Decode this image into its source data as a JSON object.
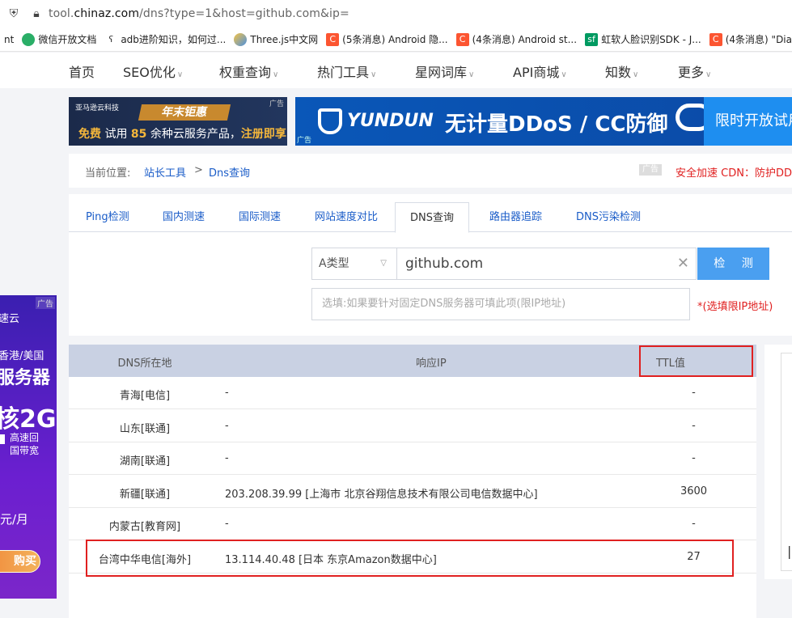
{
  "browser": {
    "url_prefix": "tool.",
    "url_domain": "chinaz.com",
    "url_rest": "/dns?type=1&host=github.com&ip=",
    "bookmarks": [
      {
        "label": "nt",
        "icon": "none",
        "color": "#ffffff"
      },
      {
        "label": "微信开放文档",
        "icon": "wechat-icon",
        "color": "#2aae67"
      },
      {
        "label": "adb进阶知识，如何过...",
        "icon": "bookmark-icon",
        "color": "#444444"
      },
      {
        "label": "Three.js中文网",
        "icon": "threejs-icon",
        "color": "#4a90e2"
      },
      {
        "label": "(5条消息) Android 隐...",
        "icon": "csdn-icon",
        "color": "#fc5531"
      },
      {
        "label": "(4条消息) Android st...",
        "icon": "csdn-icon",
        "color": "#fc5531"
      },
      {
        "label": "虹软人脸识别SDK - J...",
        "icon": "segmentfault-icon",
        "color": "#009a61"
      },
      {
        "label": "(4条消息) \"Dial",
        "icon": "csdn-icon",
        "color": "#fc5531"
      }
    ]
  },
  "topnav": [
    {
      "label": "首页",
      "dropdown": false
    },
    {
      "label": "SEO优化",
      "dropdown": true
    },
    {
      "label": "权重查询",
      "dropdown": true
    },
    {
      "label": "热门工具",
      "dropdown": true
    },
    {
      "label": "星网词库",
      "dropdown": true
    },
    {
      "label": "API商城",
      "dropdown": true
    },
    {
      "label": "知数",
      "dropdown": true
    },
    {
      "label": "更多",
      "dropdown": true
    }
  ],
  "banner1": {
    "brand": "亚马逊云科技",
    "promo": "年末钜惠",
    "text_a": "免费",
    "text_b": "试用",
    "text_c": "85",
    "text_d": "余种云服务产品，",
    "text_e": "注册即享",
    "ad_tag": "广告"
  },
  "banner2": {
    "logo": "YUNDUN",
    "headline": "无计量DDoS / CC防御",
    "right": "限时开放试用",
    "ad_tag": "广告"
  },
  "breadcrumb": {
    "label": "当前位置:",
    "link1": "站长工具",
    "sep": ">",
    "link2": "Dns查询",
    "ad_tag": "广告",
    "cdn_text": "安全加速 CDN：防护DDoS"
  },
  "tabs": [
    "Ping检测",
    "国内测速",
    "国际测速",
    "网站速度对比",
    "DNS查询",
    "路由器追踪",
    "DNS污染检测"
  ],
  "active_tab": "DNS查询",
  "form": {
    "type_value": "A类型",
    "host_value": "github.com",
    "submit_label": "检 测",
    "ip_placeholder": "选填:如果要针对固定DNS服务器可填此项(限IP地址)",
    "ip_note": "*(选填限IP地址)"
  },
  "table": {
    "headers": {
      "loc": "DNS所在地",
      "ip": "响应IP",
      "ttl": "TTL值"
    },
    "rows": [
      {
        "loc": "青海[电信]",
        "ip": "-",
        "ttl": "-"
      },
      {
        "loc": "山东[联通]",
        "ip": "-",
        "ttl": "-"
      },
      {
        "loc": "湖南[联通]",
        "ip": "-",
        "ttl": "-"
      },
      {
        "loc": "新疆[联通]",
        "ip": "203.208.39.99 [上海市 北京谷翔信息技术有限公司电信数据中心]",
        "ttl": "3600"
      },
      {
        "loc": "内蒙古[教育网]",
        "ip": "-",
        "ttl": "-"
      },
      {
        "loc": "台湾中华电信[海外]",
        "ip": "13.114.40.48 [日本 东京Amazon数据中心]",
        "ttl": "27"
      }
    ]
  },
  "leftad": {
    "ad_tag": "广告",
    "l1": "速云",
    "l2": "香港/美国",
    "l3": "服务器",
    "l4": "核2G",
    "l5a": "高速回",
    "l5b": "国带宽",
    "l6": "元/月",
    "buy": "购买"
  },
  "colors": {
    "accent": "#1a5cc8",
    "button": "#4a9ff0",
    "highlight": "#e02020",
    "table_header": "#c9d1e3"
  }
}
